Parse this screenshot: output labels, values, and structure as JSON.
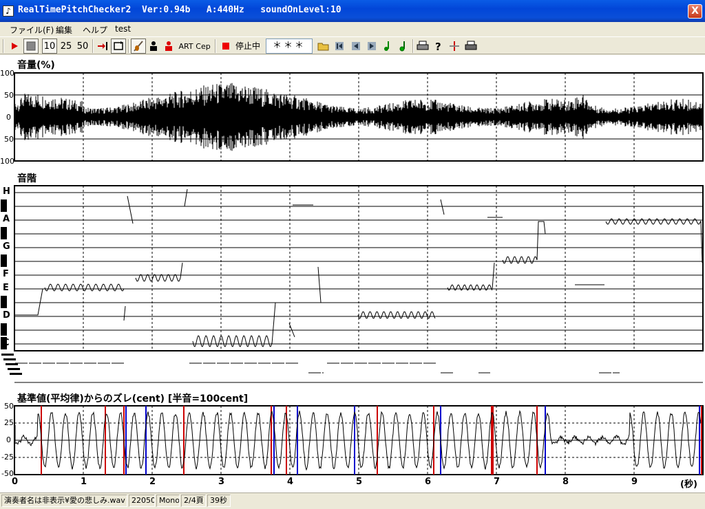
{
  "window": {
    "title": "RealTimePitchChecker2  Ver:0.94b   A:440Hz   soundOnLevel:10",
    "close_glyph": "X"
  },
  "menu": [
    "ファイル(F)",
    "編集",
    "ヘルプ",
    "test"
  ],
  "toolbar": {
    "play_icon": "play-icon",
    "stop_icon": "stop-icon",
    "zoom_options": [
      "10",
      "25",
      "50"
    ],
    "art_label": "ART",
    "cep_label": "Cep",
    "stop_status": "停止中",
    "field_value": "＊＊＊"
  },
  "panels": {
    "volume": {
      "title": "音量(%)",
      "y_labels": [
        "100",
        "50",
        "0",
        "50",
        "100"
      ]
    },
    "scale": {
      "title": "音階",
      "notes": [
        "H",
        "A",
        "G",
        "F",
        "E",
        "D",
        "C"
      ]
    },
    "deviation": {
      "title": "基準値(平均律)からのズレ(cent) [半音=100cent]",
      "y_labels": [
        "50",
        "25",
        "0",
        "-25",
        "-50"
      ]
    }
  },
  "x_axis": {
    "ticks": [
      "0",
      "1",
      "2",
      "3",
      "4",
      "5",
      "6",
      "7",
      "8",
      "9"
    ],
    "unit": "(秒)"
  },
  "status": {
    "file": "演奏者名は非表示¥愛の悲しみ.wav",
    "rate": "22050",
    "channels": "Mono",
    "page": "2/4頁",
    "length": "39秒"
  }
}
